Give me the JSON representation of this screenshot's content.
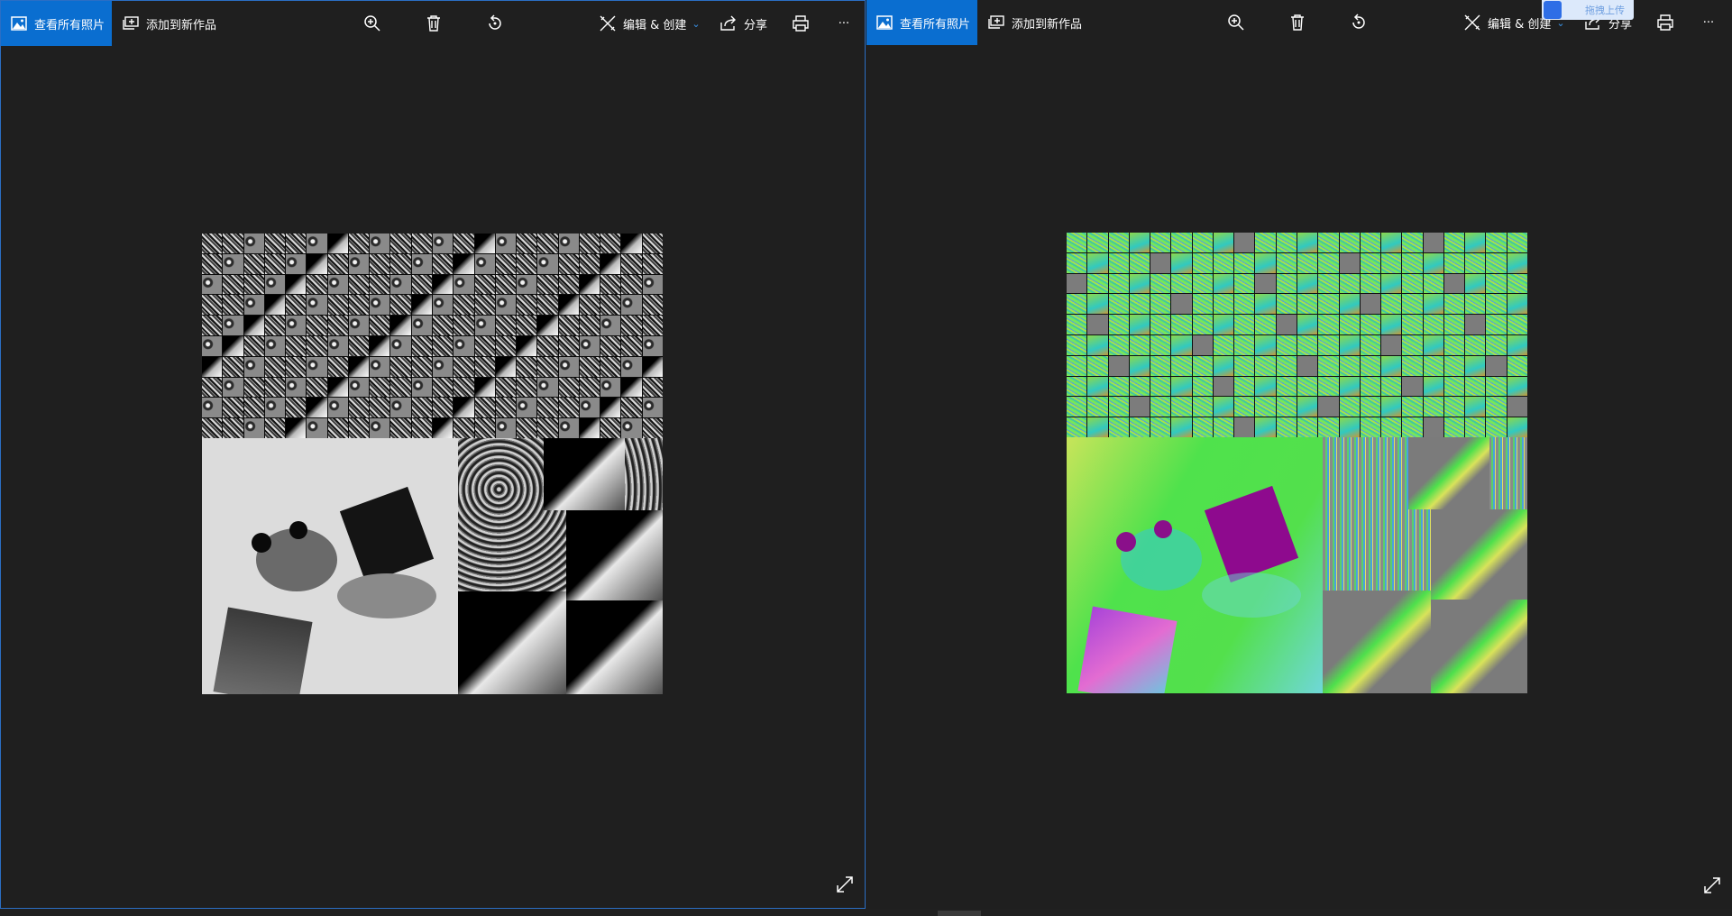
{
  "windows": [
    {
      "view_all_label": "查看所有照片",
      "add_to_creation_label": "添加到新作品",
      "edit_create_label": "编辑 & 创建",
      "share_label": "分享",
      "more_label": "···"
    },
    {
      "view_all_label": "查看所有照片",
      "add_to_creation_label": "添加到新作品",
      "edit_create_label": "编辑 & 创建",
      "share_label": "分享",
      "more_label": "···"
    }
  ],
  "upload_badge": {
    "label": "拖拽上传"
  },
  "icons": {
    "view_all": "photo-landscape-icon",
    "add_creation": "add-to-album-icon",
    "zoom": "zoom-in-icon",
    "delete": "trash-icon",
    "rotate": "rotate-icon",
    "edit": "edit-create-icon",
    "share": "share-icon",
    "print": "print-icon",
    "expand": "expand-icon"
  },
  "colors": {
    "accent": "#0a6ed0",
    "background": "#1f1f1f",
    "chevron": "#3a93ea"
  }
}
